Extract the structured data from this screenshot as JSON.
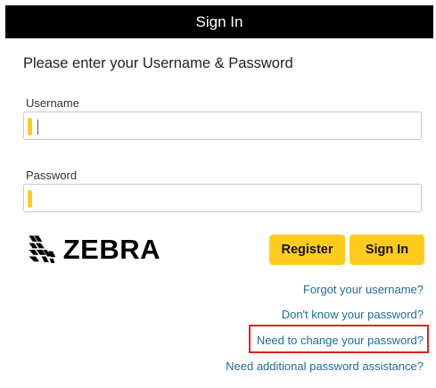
{
  "header": {
    "title": "Sign In"
  },
  "form": {
    "instruction": "Please enter your Username & Password",
    "username": {
      "label": "Username",
      "value": ""
    },
    "password": {
      "label": "Password",
      "value": ""
    }
  },
  "logo": {
    "text": "ZEBRA",
    "icon": "zebra-head-icon"
  },
  "buttons": {
    "register": "Register",
    "signin": "Sign In"
  },
  "links": {
    "forgot_username": "Forgot your username?",
    "dont_know_password": "Don't know your password?",
    "change_password": "Need to change your password?",
    "assistance": "Need additional password assistance?"
  },
  "colors": {
    "header_bg": "#000000",
    "accent": "#ffcc1e",
    "link": "#1f6d9e",
    "highlight": "#e2231a"
  }
}
